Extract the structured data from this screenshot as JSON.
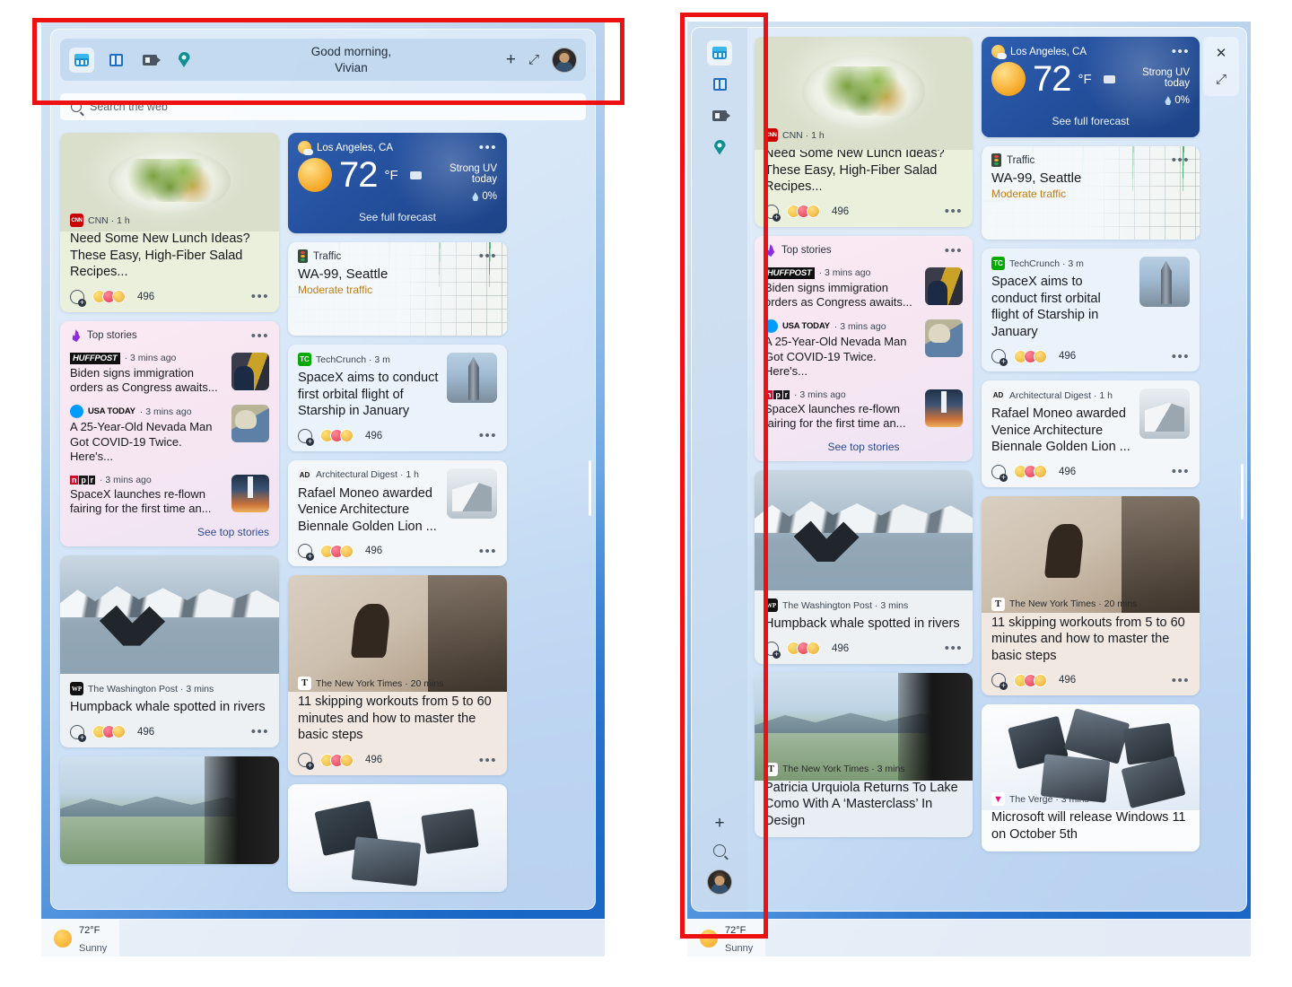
{
  "header": {
    "greeting_line1": "Good morning,",
    "greeting_line2": "Vivian",
    "add_label": "+",
    "expand_label": "⤢",
    "icons": [
      "widgets-icon",
      "board-icon",
      "video-icon",
      "location-pin-icon"
    ]
  },
  "search": {
    "placeholder": "Search the web"
  },
  "window_controls": {
    "close": "✕",
    "expand": "⤢"
  },
  "rail": {
    "add_label": "+",
    "icons": [
      "widgets-icon",
      "board-icon",
      "video-icon",
      "location-pin-icon"
    ]
  },
  "weather": {
    "location": "Los Angeles, CA",
    "temp": "72",
    "unit": "°F",
    "uv": "Strong UV today",
    "precip": "0%",
    "link": "See full forecast",
    "more": "•••"
  },
  "traffic": {
    "title": "Traffic",
    "road": "WA-99, Seattle",
    "status": "Moderate traffic",
    "more": "•••"
  },
  "top_stories": {
    "title": "Top stories",
    "more": "•••",
    "link": "See top stories",
    "items": [
      {
        "source": "HUFFPOST",
        "time": "3 mins ago",
        "headline": "Biden signs immigration orders as Congress awaits..."
      },
      {
        "source": "USA TODAY",
        "time": "3 mins ago",
        "headline": "A 25-Year-Old Nevada Man Got COVID-19 Twice. Here's..."
      },
      {
        "source": "npr",
        "time": "3 mins ago",
        "headline": "SpaceX launches re-flown fairing for the first time an..."
      }
    ]
  },
  "cards": {
    "cnn": {
      "source": "CNN",
      "time": "1 h",
      "headline": "Need Some New Lunch Ideas? These Easy, High-Fiber Salad Recipes...",
      "reactions": "496",
      "more": "•••"
    },
    "techcrunch": {
      "source": "TechCrunch",
      "time": "3 m",
      "headline": "SpaceX aims to conduct first orbital flight of Starship in January",
      "reactions": "496",
      "more": "•••"
    },
    "archdigest": {
      "source": "Architectural Digest",
      "time": "1 h",
      "headline": "Rafael Moneo awarded Venice Architecture Biennale Golden Lion ...",
      "reactions": "496",
      "more": "•••"
    },
    "wapo": {
      "source": "The Washington Post",
      "time": "3 mins",
      "headline": "Humpback whale spotted in rivers",
      "reactions": "496",
      "more": "•••"
    },
    "nyt_skipping": {
      "source": "The New York Times",
      "time": "20 mins",
      "headline": "11 skipping workouts from 5 to 60 minutes and how to master the basic steps",
      "reactions": "496",
      "more": "•••"
    },
    "nyt_lake": {
      "source": "The New York Times",
      "time": "3 mins",
      "headline": "Patricia Urquiola Returns To Lake Como With A ‘Masterclass’ In Design"
    },
    "verge": {
      "source": "The Verge",
      "time": "3 mins",
      "headline": "Microsoft will release Windows 11 on October 5th"
    }
  },
  "taskbar": {
    "temp": "72°F",
    "condition": "Sunny"
  },
  "colors": {
    "annotation": "#ee1111",
    "weather_card": "#24509e",
    "traffic_status": "#c07c10",
    "link": "#2b4a8f"
  }
}
